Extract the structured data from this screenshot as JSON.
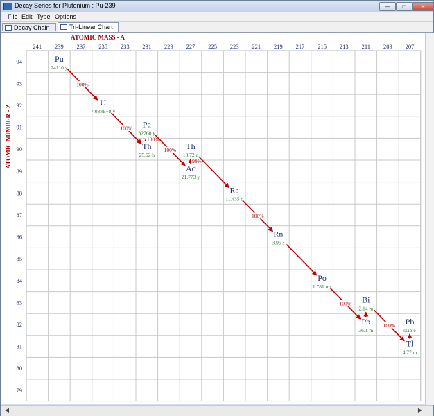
{
  "window": {
    "title": "Decay Series for Plutonium : Pu-239"
  },
  "menu": [
    "File",
    "Edit",
    "Type",
    "Options"
  ],
  "tabs": [
    {
      "label": "Decay Chain",
      "active": false
    },
    {
      "label": "Tri-Linear Chart",
      "active": true
    }
  ],
  "colors": {
    "nuclide": "#1c2e6e",
    "halflife": "#2a7a2a",
    "arrow": "#cc0000",
    "percent": "#aa0000",
    "axis": "#1c2e6e",
    "axis_title": "#a00000"
  },
  "chart_data": {
    "type": "table",
    "x_axis": {
      "label": "ATOMIC MASS - A",
      "ticks": [
        241,
        239,
        237,
        235,
        233,
        231,
        229,
        227,
        225,
        223,
        221,
        219,
        217,
        215,
        213,
        211,
        209,
        207
      ]
    },
    "y_axis": {
      "label": "ATOMIC NUMBER - Z",
      "ticks": [
        94,
        93,
        92,
        91,
        90,
        89,
        88,
        87,
        86,
        85,
        84,
        83,
        82,
        81,
        80,
        79
      ]
    },
    "nuclides": [
      {
        "symbol": "Pu",
        "A": 239,
        "Z": 94,
        "half_life": "24110 y"
      },
      {
        "symbol": "U",
        "A": 235,
        "Z": 92,
        "half_life": "7.038E+8 y"
      },
      {
        "symbol": "Th",
        "A": 231,
        "Z": 90,
        "half_life": "25.52 h"
      },
      {
        "symbol": "Pa",
        "A": 231,
        "Z": 91,
        "half_life": "32760 y"
      },
      {
        "symbol": "Ac",
        "A": 227,
        "Z": 89,
        "half_life": "21.773 y"
      },
      {
        "symbol": "Th",
        "A": 227,
        "Z": 90,
        "half_life": "18.72 d"
      },
      {
        "symbol": "Ra",
        "A": 223,
        "Z": 88,
        "half_life": "11.435 d"
      },
      {
        "symbol": "Rn",
        "A": 219,
        "Z": 86,
        "half_life": "3.96 s"
      },
      {
        "symbol": "Po",
        "A": 215,
        "Z": 84,
        "half_life": "1.781 ms"
      },
      {
        "symbol": "Pb",
        "A": 211,
        "Z": 82,
        "half_life": "36.1 m"
      },
      {
        "symbol": "Bi",
        "A": 211,
        "Z": 83,
        "half_life": "2.14 m"
      },
      {
        "symbol": "Tl",
        "A": 207,
        "Z": 81,
        "half_life": "4.77 m"
      },
      {
        "symbol": "Pb",
        "A": 207,
        "Z": 82,
        "half_life": "stable"
      }
    ],
    "decays": [
      {
        "from": [
          239,
          94
        ],
        "to": [
          235,
          92
        ],
        "percent": "100%"
      },
      {
        "from": [
          235,
          92
        ],
        "to": [
          231,
          90
        ],
        "percent": "100%"
      },
      {
        "from": [
          231,
          90
        ],
        "to": [
          231,
          91
        ],
        "percent": "100%"
      },
      {
        "from": [
          231,
          91
        ],
        "to": [
          227,
          89
        ],
        "percent": "100%"
      },
      {
        "from": [
          227,
          89
        ],
        "to": [
          227,
          90
        ],
        "percent": "99%"
      },
      {
        "from": [
          227,
          90
        ],
        "to": [
          223,
          88
        ],
        "percent": ""
      },
      {
        "from": [
          223,
          88
        ],
        "to": [
          219,
          86
        ],
        "percent": "100%"
      },
      {
        "from": [
          219,
          86
        ],
        "to": [
          215,
          84
        ],
        "percent": ""
      },
      {
        "from": [
          215,
          84
        ],
        "to": [
          211,
          82
        ],
        "percent": "100%"
      },
      {
        "from": [
          211,
          82
        ],
        "to": [
          211,
          83
        ],
        "percent": ""
      },
      {
        "from": [
          211,
          83
        ],
        "to": [
          207,
          81
        ],
        "percent": "100%"
      },
      {
        "from": [
          207,
          81
        ],
        "to": [
          207,
          82
        ],
        "percent": ""
      }
    ]
  }
}
